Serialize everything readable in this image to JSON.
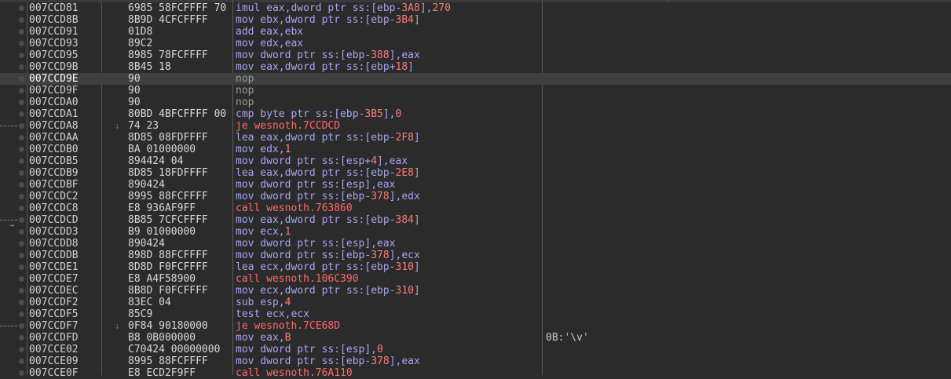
{
  "rows": [
    {
      "address": "007CCD81",
      "bytes": "6985 58FCFFFF 70",
      "disasm": "imul eax,dword ptr ss:[ebp-3A8],270",
      "kind": "normal",
      "comment": ""
    },
    {
      "address": "007CCD8B",
      "bytes": "8B9D 4CFCFFFF",
      "disasm": "mov ebx,dword ptr ss:[ebp-3B4]",
      "kind": "normal",
      "comment": ""
    },
    {
      "address": "007CCD91",
      "bytes": "01D8",
      "disasm": "add eax,ebx",
      "kind": "normal",
      "comment": ""
    },
    {
      "address": "007CCD93",
      "bytes": "89C2",
      "disasm": "mov edx,eax",
      "kind": "normal",
      "comment": ""
    },
    {
      "address": "007CCD95",
      "bytes": "8985 78FCFFFF",
      "disasm": "mov dword ptr ss:[ebp-388],eax",
      "kind": "normal",
      "comment": ""
    },
    {
      "address": "007CCD9B",
      "bytes": "8B45 18",
      "disasm": "mov eax,dword ptr ss:[ebp+18]",
      "kind": "normal",
      "comment": ""
    },
    {
      "address": "007CCD9E",
      "bytes": "90",
      "disasm": "nop",
      "kind": "nop",
      "comment": "",
      "selected": true
    },
    {
      "address": "007CCD9F",
      "bytes": "90",
      "disasm": "nop",
      "kind": "nop",
      "comment": ""
    },
    {
      "address": "007CCDA0",
      "bytes": "90",
      "disasm": "nop",
      "kind": "nop",
      "comment": ""
    },
    {
      "address": "007CCDA1",
      "bytes": "80BD 4BFCFFFF 00",
      "disasm": "cmp byte ptr ss:[ebp-3B5],0",
      "kind": "normal",
      "comment": ""
    },
    {
      "address": "007CCDA8",
      "bytes": "74 23",
      "disasm": "je wesnoth.7CCDCD",
      "kind": "jmp",
      "comment": "",
      "jump_source": true,
      "marker": "↓"
    },
    {
      "address": "007CCDAA",
      "bytes": "8D85 08FDFFFF",
      "disasm": "lea eax,dword ptr ss:[ebp-2F8]",
      "kind": "normal",
      "comment": ""
    },
    {
      "address": "007CCDB0",
      "bytes": "BA 01000000",
      "disasm": "mov edx,1",
      "kind": "normal",
      "comment": ""
    },
    {
      "address": "007CCDB5",
      "bytes": "894424 04",
      "disasm": "mov dword ptr ss:[esp+4],eax",
      "kind": "normal",
      "comment": ""
    },
    {
      "address": "007CCDB9",
      "bytes": "8D85 18FDFFFF",
      "disasm": "lea eax,dword ptr ss:[ebp-2E8]",
      "kind": "normal",
      "comment": ""
    },
    {
      "address": "007CCDBF",
      "bytes": "890424",
      "disasm": "mov dword ptr ss:[esp],eax",
      "kind": "normal",
      "comment": ""
    },
    {
      "address": "007CCDC2",
      "bytes": "8995 88FCFFFF",
      "disasm": "mov dword ptr ss:[ebp-378],edx",
      "kind": "normal",
      "comment": ""
    },
    {
      "address": "007CCDC8",
      "bytes": "E8 936AF9FF",
      "disasm": "call wesnoth.763860",
      "kind": "call",
      "comment": ""
    },
    {
      "address": "007CCDCD",
      "bytes": "8B85 7CFCFFFF",
      "disasm": "mov eax,dword ptr ss:[ebp-384]",
      "kind": "normal",
      "comment": "",
      "jump_target": true
    },
    {
      "address": "007CCDD3",
      "bytes": "B9 01000000",
      "disasm": "mov ecx,1",
      "kind": "normal",
      "comment": ""
    },
    {
      "address": "007CCDD8",
      "bytes": "890424",
      "disasm": "mov dword ptr ss:[esp],eax",
      "kind": "normal",
      "comment": ""
    },
    {
      "address": "007CCDDB",
      "bytes": "898D 88FCFFFF",
      "disasm": "mov dword ptr ss:[ebp-378],ecx",
      "kind": "normal",
      "comment": ""
    },
    {
      "address": "007CCDE1",
      "bytes": "8D8D F0FCFFFF",
      "disasm": "lea ecx,dword ptr ss:[ebp-310]",
      "kind": "normal",
      "comment": ""
    },
    {
      "address": "007CCDE7",
      "bytes": "E8 A4F58900",
      "disasm": "call wesnoth.106C390",
      "kind": "call",
      "comment": ""
    },
    {
      "address": "007CCDEC",
      "bytes": "8B8D F0FCFFFF",
      "disasm": "mov ecx,dword ptr ss:[ebp-310]",
      "kind": "normal",
      "comment": ""
    },
    {
      "address": "007CCDF2",
      "bytes": "83EC 04",
      "disasm": "sub esp,4",
      "kind": "normal",
      "comment": ""
    },
    {
      "address": "007CCDF5",
      "bytes": "85C9",
      "disasm": "test ecx,ecx",
      "kind": "normal",
      "comment": ""
    },
    {
      "address": "007CCDF7",
      "bytes": "0F84 90180000",
      "disasm": "je wesnoth.7CE68D",
      "kind": "jmp",
      "comment": "",
      "jump_source": true,
      "marker": "↓"
    },
    {
      "address": "007CCDFD",
      "bytes": "B8 0B000000",
      "disasm": "mov eax,B",
      "kind": "normal",
      "comment": "0B:'\\v'"
    },
    {
      "address": "007CCE02",
      "bytes": "C70424 00000000",
      "disasm": "mov dword ptr ss:[esp],0",
      "kind": "normal",
      "comment": ""
    },
    {
      "address": "007CCE09",
      "bytes": "8995 88FCFFFF",
      "disasm": "mov dword ptr ss:[ebp-378],eax",
      "kind": "normal",
      "comment": ""
    },
    {
      "address": "007CCE0F",
      "bytes": "E8 ECD2F9FF",
      "disasm": "call wesnoth.76A110",
      "kind": "call",
      "comment": ""
    }
  ]
}
